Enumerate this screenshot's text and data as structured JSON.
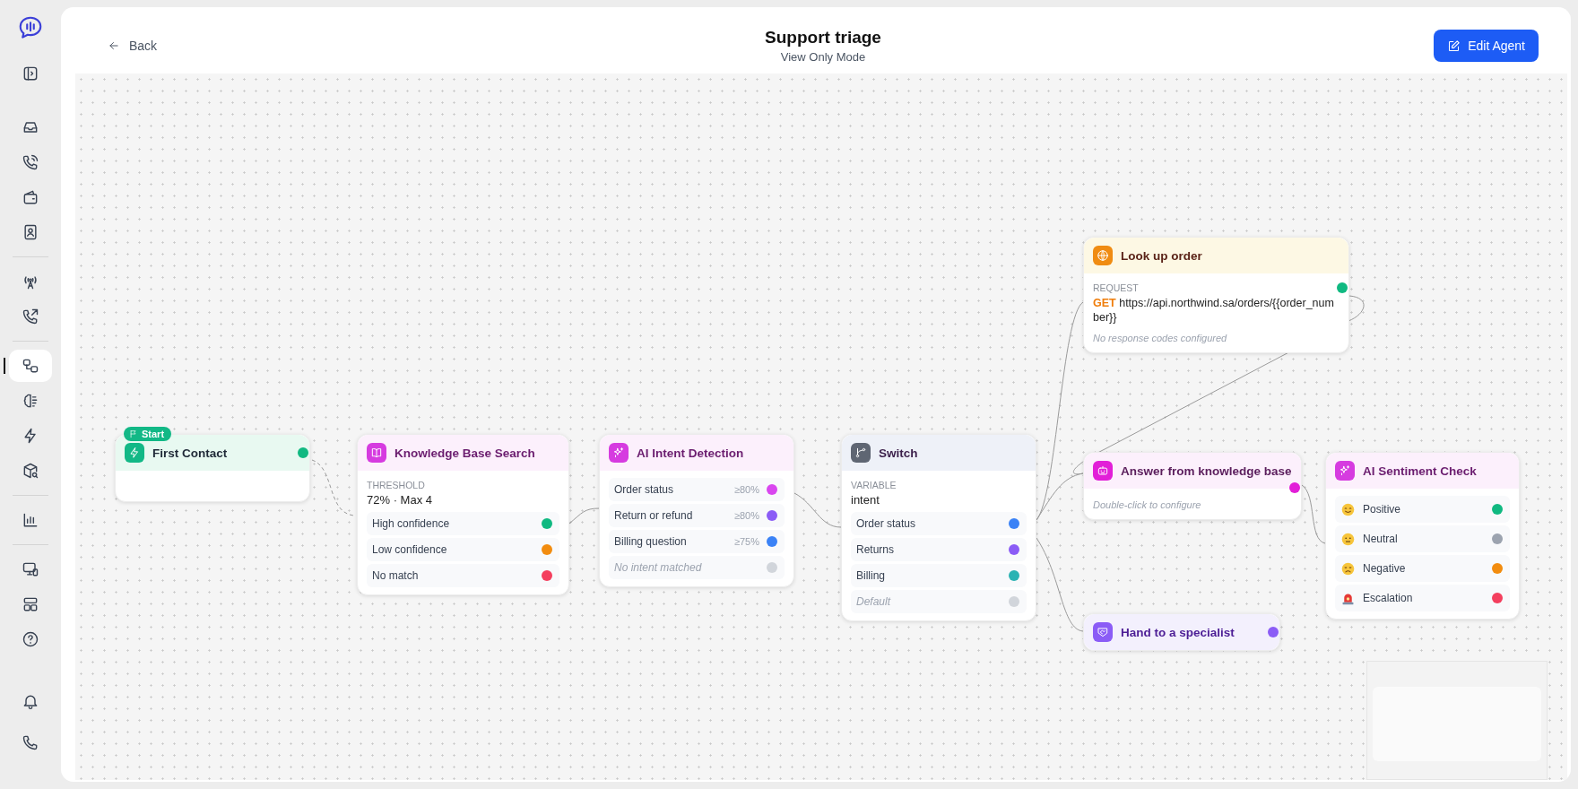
{
  "header": {
    "back_label": "Back",
    "title": "Support triage",
    "subtitle": "View Only Mode",
    "edit_button": "Edit Agent"
  },
  "sidebar": {
    "groups": [
      [
        {
          "selected": false
        },
        {
          "selected": false
        },
        {
          "selected": false
        },
        {
          "selected": false
        }
      ],
      [
        {
          "selected": false
        },
        {
          "selected": false
        }
      ],
      [
        {
          "selected": true
        },
        {
          "selected": false
        },
        {
          "selected": false
        },
        {
          "selected": false
        }
      ],
      [
        {
          "selected": false
        }
      ],
      [
        {
          "selected": false
        },
        {
          "selected": false
        },
        {
          "selected": false
        }
      ]
    ],
    "bottom": [
      {
        "selected": false
      },
      {
        "selected": false
      }
    ]
  },
  "nodes": [
    {
      "kind": "trigger",
      "title": "First Contact",
      "badge": "Start",
      "color": "#10b981"
    },
    {
      "kind": "kb_search",
      "title": "Knowledge Base Search",
      "field_label": "THRESHOLD",
      "field_value": "72% · Max 4",
      "outputs": [
        {
          "label": "High confidence",
          "color": "#10b981"
        },
        {
          "label": "Low confidence",
          "color": "#f28c0f"
        },
        {
          "label": "No match",
          "color": "#f43f5e"
        }
      ]
    },
    {
      "kind": "ai_intent",
      "title": "AI Intent Detection",
      "outputs": [
        {
          "label": "Order status",
          "threshold": "≥80%",
          "fallback": false,
          "color": "#d946ef"
        },
        {
          "label": "Return or refund",
          "threshold": "≥80%",
          "fallback": false,
          "color": "#8b5cf6"
        },
        {
          "label": "Billing question",
          "threshold": "≥75%",
          "fallback": false,
          "color": "#3b82f6"
        },
        {
          "label": "No intent matched",
          "fallback": true,
          "color": "#d1d5db"
        }
      ]
    },
    {
      "kind": "switch",
      "title": "Switch",
      "field_label": "VARIABLE",
      "field_value": "intent",
      "outputs": [
        {
          "label": "Order status",
          "fallback": false,
          "color": "#3b82f6"
        },
        {
          "label": "Returns",
          "fallback": false,
          "color": "#8b5cf6"
        },
        {
          "label": "Billing",
          "fallback": false,
          "color": "#2bb3b3"
        },
        {
          "label": "Default",
          "fallback": true,
          "color": "#d1d5db"
        }
      ]
    },
    {
      "kind": "http",
      "title": "Look up order",
      "field_label": "REQUEST",
      "method": "GET",
      "url": "https://api.northwind.sa/orders/{{order_number}}",
      "note": "No response codes configured",
      "color": "#10b981"
    },
    {
      "kind": "ai_answer",
      "title": "Answer from knowledge base",
      "note": "Double-click to configure",
      "color": "#e21fd8"
    },
    {
      "kind": "handoff",
      "title": "Hand to a specialist",
      "color": "#8b5cf6"
    },
    {
      "kind": "sentiment",
      "title": "AI Sentiment Check",
      "outputs": [
        {
          "kind": "smile",
          "label": "Positive",
          "color": "#10b981"
        },
        {
          "kind": "neutral",
          "label": "Neutral",
          "color": "#9ca3af"
        },
        {
          "kind": "sad",
          "label": "Negative",
          "color": "#f28c0f"
        },
        {
          "kind": "siren",
          "label": "Escalation",
          "color": "#f43f5e"
        }
      ]
    }
  ]
}
